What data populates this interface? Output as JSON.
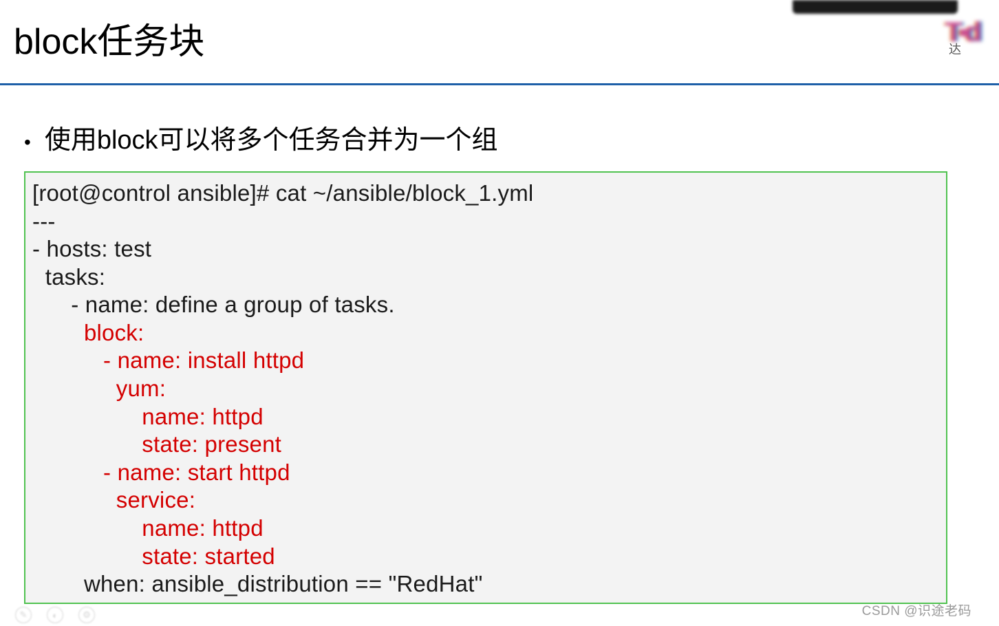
{
  "header": {
    "title": "block任务块",
    "corner_text": "达"
  },
  "bullet": {
    "text": "使用block可以将多个任务合并为一个组"
  },
  "code": {
    "line1": "[root@control ansible]# cat ~/ansible/block_1.yml",
    "line2": "---",
    "line3": "- hosts: test",
    "line4": "  tasks:",
    "line5": "      - name: define a group of tasks.",
    "line6": "        block:",
    "line7": "           - name: install httpd",
    "line8": "             yum:",
    "line9": "                 name: httpd",
    "line10": "                 state: present",
    "line11": "           - name: start httpd",
    "line12": "             service:",
    "line13": "                 name: httpd",
    "line14": "                 state: started",
    "line15": "        when: ansible_distribution == \"RedHat\""
  },
  "watermark": "CSDN @识途老码"
}
